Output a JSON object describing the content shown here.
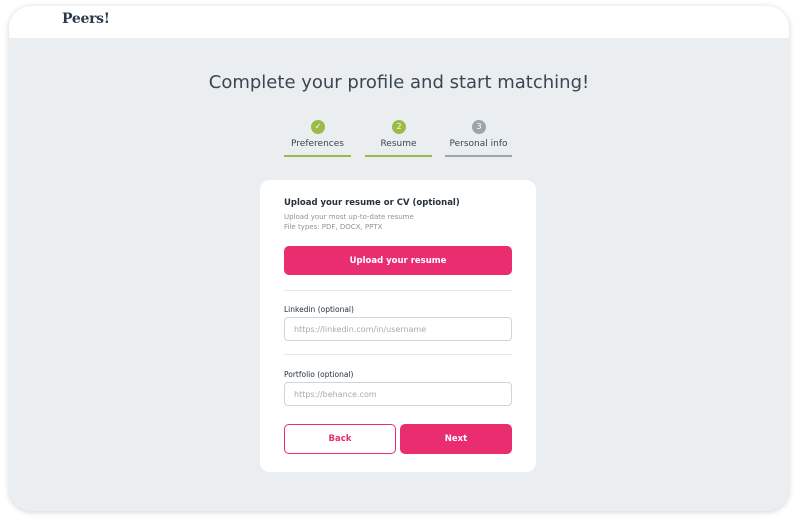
{
  "brand": {
    "logo_text": "Peers!"
  },
  "page": {
    "title": "Complete your profile and start matching!"
  },
  "steps": [
    {
      "number": "✓",
      "label": "Preferences",
      "state": "done"
    },
    {
      "number": "2",
      "label": "Resume",
      "state": "current"
    },
    {
      "number": "3",
      "label": "Personal info",
      "state": "todo"
    }
  ],
  "upload": {
    "title": "Upload your resume or CV (optional)",
    "hint": "Upload your most up-to-date resume",
    "file_types": "File types: PDF, DOCX, PPTX",
    "button_label": "Upload your resume"
  },
  "linkedin": {
    "label": "Linkedin (optional)",
    "placeholder": "https://linkedin.com/in/username",
    "value": ""
  },
  "portfolio": {
    "label": "Portfolio (optional)",
    "placeholder": "https://behance.com",
    "value": ""
  },
  "actions": {
    "back_label": "Back",
    "next_label": "Next"
  },
  "colors": {
    "accent": "#ea2d6f",
    "step_complete": "#9bbb47",
    "step_pending": "#9aa5ae",
    "background": "#ebeef1"
  }
}
